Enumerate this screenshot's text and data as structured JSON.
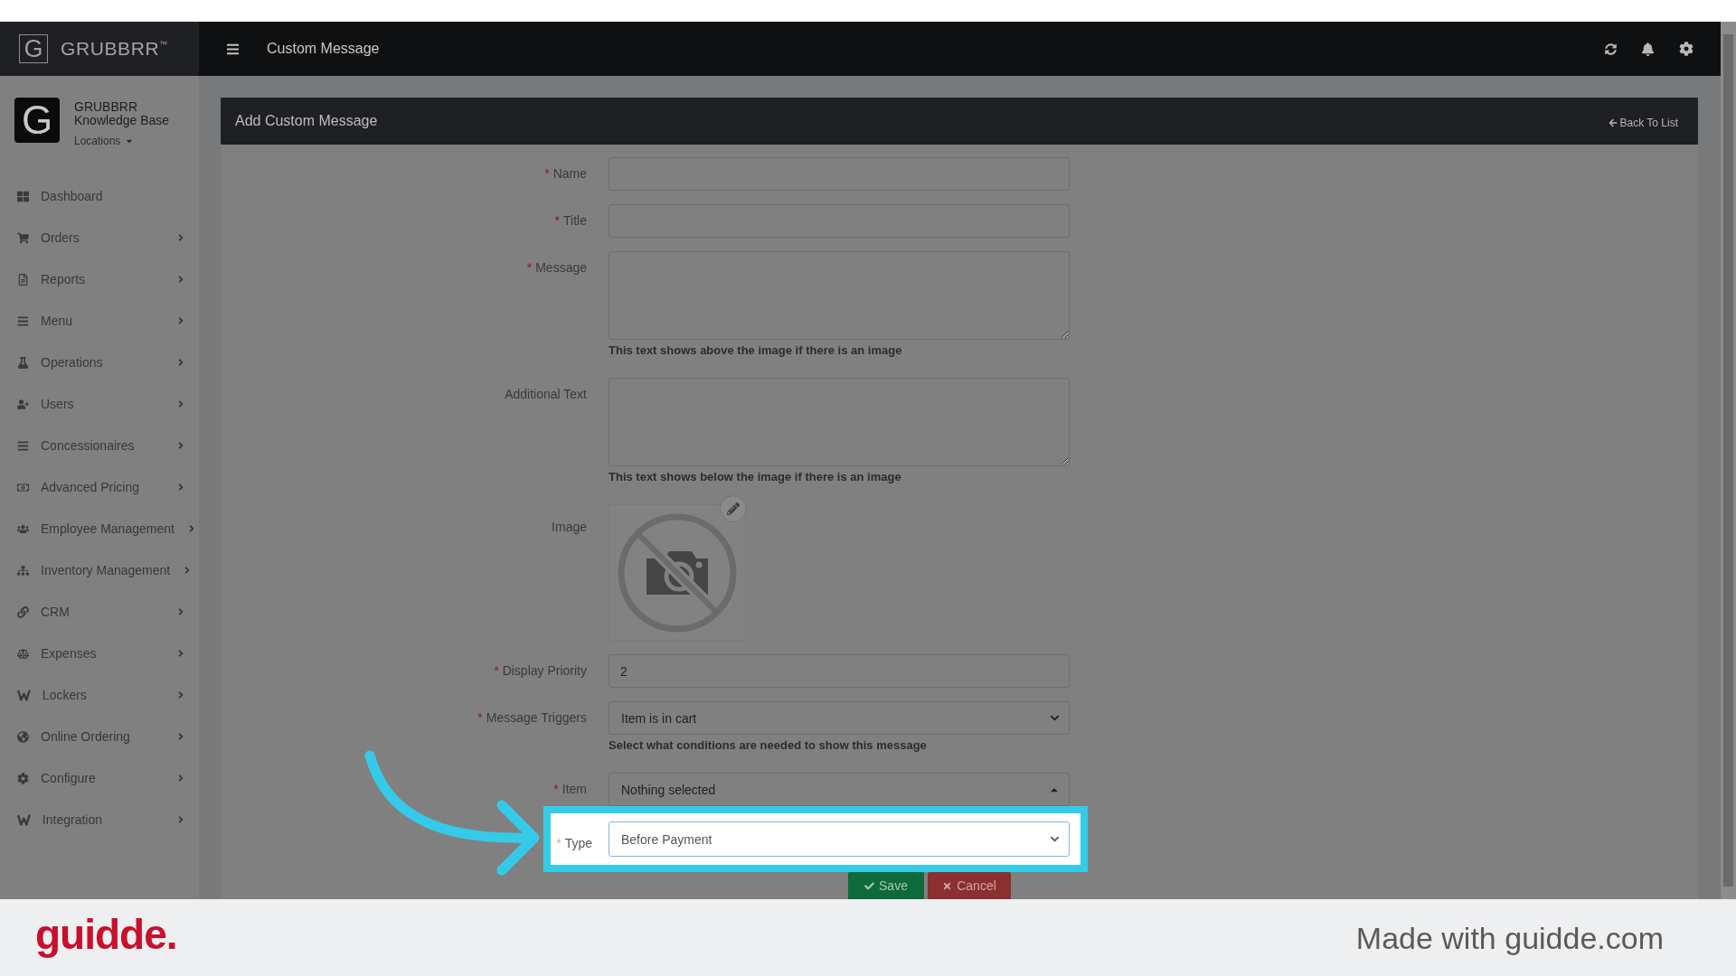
{
  "top_bar": {
    "logo_letter": "G",
    "brand": "GRUBBRR$^{™}$",
    "page_title": "Custom Message"
  },
  "sidebar": {
    "profile": {
      "logo_letter": "G",
      "name": "GRUBBRR Knowledge Base",
      "locations": "Locations"
    },
    "items": [
      {
        "label": "Dashboard",
        "has_submenu": false
      },
      {
        "label": "Orders",
        "has_submenu": true
      },
      {
        "label": "Reports",
        "has_submenu": true
      },
      {
        "label": "Menu",
        "has_submenu": true
      },
      {
        "label": "Operations",
        "has_submenu": true
      },
      {
        "label": "Users",
        "has_submenu": true
      },
      {
        "label": "Concessionaires",
        "has_submenu": true
      },
      {
        "label": "Advanced Pricing",
        "has_submenu": true
      },
      {
        "label": "Employee Management",
        "has_submenu": true
      },
      {
        "label": "Inventory Management",
        "has_submenu": true
      },
      {
        "label": "CRM",
        "has_submenu": true
      },
      {
        "label": "Expenses",
        "has_submenu": true
      },
      {
        "label": "Lockers",
        "has_submenu": true
      },
      {
        "label": "Online Ordering",
        "has_submenu": true
      },
      {
        "label": "Configure",
        "has_submenu": true
      },
      {
        "label": "Integration",
        "has_submenu": true
      }
    ]
  },
  "panel": {
    "title": "Add Custom Message",
    "back_link": "Back To List",
    "fields": [
      {
        "kind": "input",
        "label": "Name",
        "required_mark": "*",
        "highlighted": false
      },
      {
        "kind": "input",
        "label": "Title",
        "required_mark": "*",
        "highlighted": false
      },
      {
        "kind": "textarea",
        "label": "Message",
        "required_mark": "*",
        "help": "This text shows above the image if there is an image",
        "highlighted": false
      },
      {
        "kind": "textarea",
        "label": "Additional Text",
        "help": "This text shows below the image if there is an image",
        "highlighted": false
      },
      {
        "kind": "image",
        "label": "Image",
        "highlighted": false
      },
      {
        "kind": "input",
        "label": "Display Priority",
        "required_mark": "*",
        "value": "2",
        "highlighted": false
      },
      {
        "kind": "select",
        "label": "Message Triggers",
        "required_mark": "*",
        "value": "Item is in cart",
        "help": "Select what conditions are needed to show this message",
        "highlighted": false
      },
      {
        "kind": "picker",
        "label": "Item",
        "required_mark": "*",
        "value": "Nothing selected",
        "expanded": true,
        "highlighted": false
      },
      {
        "kind": "select",
        "label": "Type",
        "required_mark": "*",
        "value": "Before Payment",
        "highlighted": true
      }
    ],
    "buttons": [
      {
        "kind": "save",
        "label": "Save"
      },
      {
        "kind": "cancel",
        "label": "Cancel"
      }
    ]
  },
  "footer": {
    "logo": "guidde.",
    "credit": "Made with guidde.com"
  }
}
